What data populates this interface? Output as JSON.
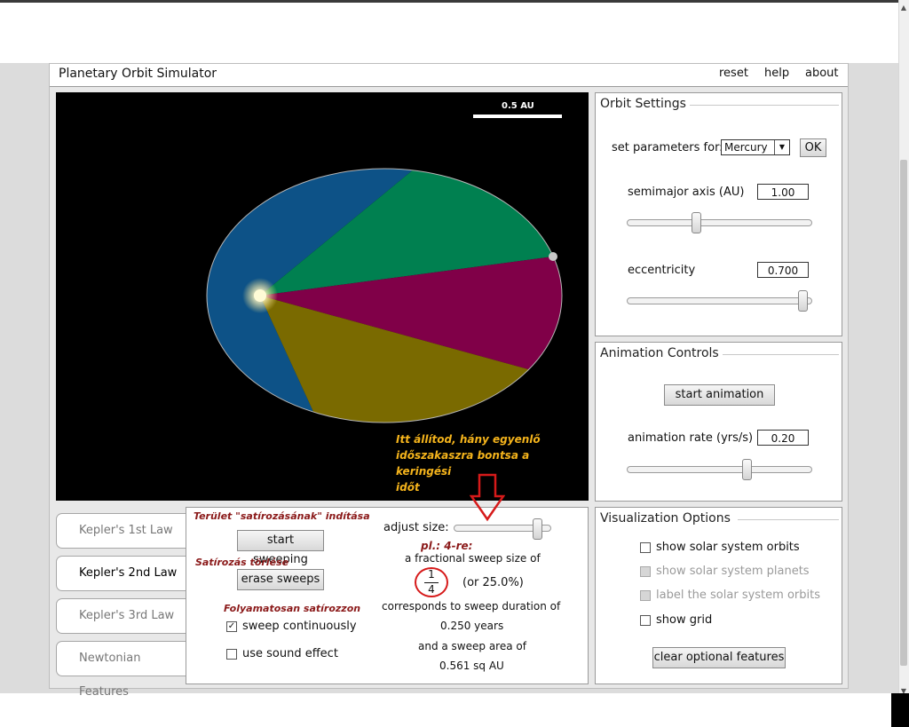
{
  "app": {
    "title": "Planetary Orbit Simulator",
    "menu": [
      "reset",
      "help",
      "about"
    ]
  },
  "canvas": {
    "scale_label": "0.5 AU",
    "annotation_lines": [
      "Itt állítod, hány egyenlő",
      "időszakaszra bontsa a keringési",
      "időt"
    ],
    "sector_colors": [
      "#0d5287",
      "#008050",
      "#800048",
      "#7a6a00"
    ]
  },
  "orbit_settings": {
    "title": "Orbit Settings",
    "set_params_label": "set parameters for:",
    "planet_selected": "Mercury",
    "ok_label": "OK",
    "semimajor_label": "semimajor axis (AU)",
    "semimajor_value": "1.00",
    "eccentricity_label": "eccentricity",
    "eccentricity_value": "0.700"
  },
  "animation_controls": {
    "title": "Animation Controls",
    "start_label": "start animation",
    "rate_label": "animation rate (yrs/s)",
    "rate_value": "0.20"
  },
  "visualization": {
    "title": "Visualization Options",
    "options": [
      {
        "label": "show solar system orbits",
        "checked": false,
        "enabled": true
      },
      {
        "label": "show solar system planets",
        "checked": false,
        "enabled": false
      },
      {
        "label": "label the solar system orbits",
        "checked": false,
        "enabled": false
      },
      {
        "label": "show grid",
        "checked": false,
        "enabled": true
      }
    ],
    "clear_label": "clear optional features"
  },
  "tabs": [
    "Kepler's 1st Law",
    "Kepler's 2nd Law",
    "Kepler's 3rd Law",
    "Newtonian Features"
  ],
  "active_tab": "Kepler's 2nd Law",
  "kepler2": {
    "note_start": "Terület \"satírozásának\" indítása",
    "start_sweeping": "start sweeping",
    "note_erase": "Satírozás törlése",
    "erase_sweeps": "erase sweeps",
    "note_continuous": "Folyamatosan satírozzon",
    "sweep_continuously": "sweep continuously",
    "sweep_continuously_checked": true,
    "use_sound": "use sound effect",
    "use_sound_checked": false,
    "adjust_size": "adjust size:",
    "note_example": "pl.: 4-re:",
    "fraction_text": "a fractional sweep size of",
    "fraction_num": "1",
    "fraction_den": "4",
    "percent": "(or 25.0%)",
    "duration_text": "corresponds to sweep duration of",
    "duration_value": "0.250 years",
    "area_text": "and a sweep area of",
    "area_value": "0.561 sq AU"
  }
}
